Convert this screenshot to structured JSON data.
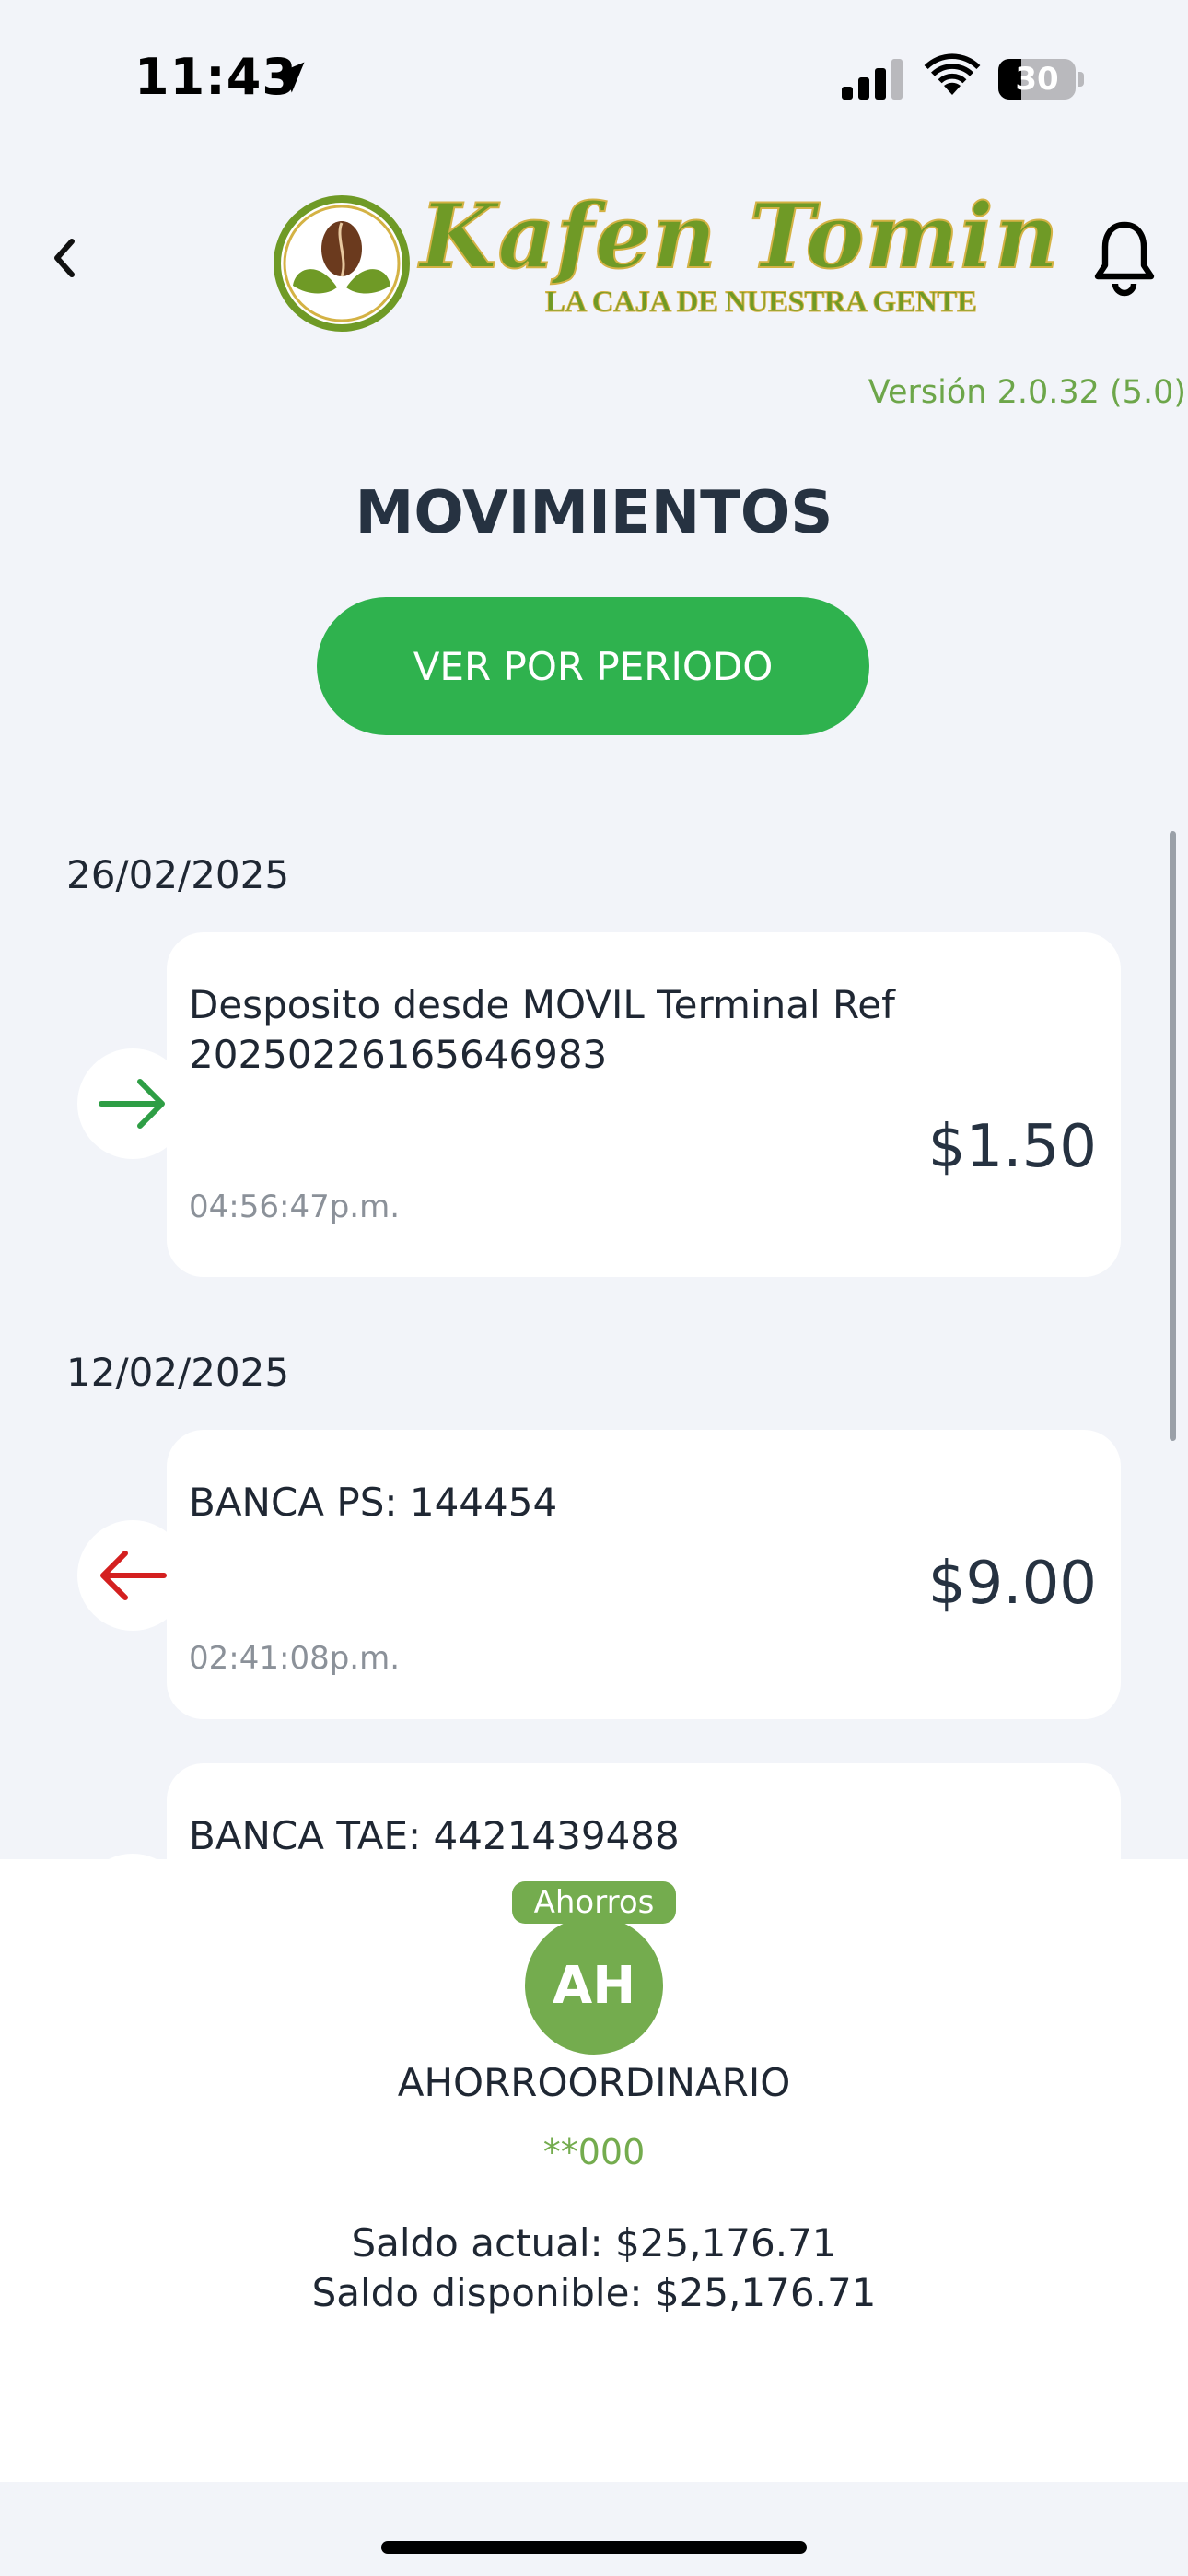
{
  "status_bar": {
    "time": "11:43",
    "battery": "30",
    "battery_level": 0.3
  },
  "header": {
    "back_icon": "chevron-left-icon",
    "notification_icon": "bell-icon",
    "logo_word": "Kafen Tomin",
    "logo_tagline": "LA CAJA DE NUESTRA GENTE"
  },
  "version": "Versión 2.0.32 (5.0)",
  "page_title": "MOVIMIENTOS",
  "period_button": "VER POR PERIODO",
  "movements": [
    {
      "date": "26/02/2025",
      "direction": "in",
      "description": "Desposito desde MOVIL Terminal  Ref 20250226165646983",
      "amount": "$1.50",
      "time": "04:56:47p.m."
    },
    {
      "date": "12/02/2025",
      "direction": "out",
      "description": "BANCA PS: 144454",
      "amount": "$9.00",
      "time": "02:41:08p.m."
    },
    {
      "date": "",
      "direction": "out",
      "description": "BANCA TAE: 4421439488",
      "amount": "",
      "time": ""
    }
  ],
  "account": {
    "tag": "Ahorros",
    "initials": "AH",
    "name": "AHORROORDINARIO",
    "number": "**000",
    "current_balance": "Saldo actual: $25,176.71",
    "available_balance": "Saldo disponible: $25,176.71"
  },
  "colors": {
    "accent_green": "#2fb24e",
    "account_green": "#74ac4e",
    "incoming_arrow": "#2e9e45",
    "outgoing_arrow": "#d42020",
    "background": "#f2f4f9"
  }
}
